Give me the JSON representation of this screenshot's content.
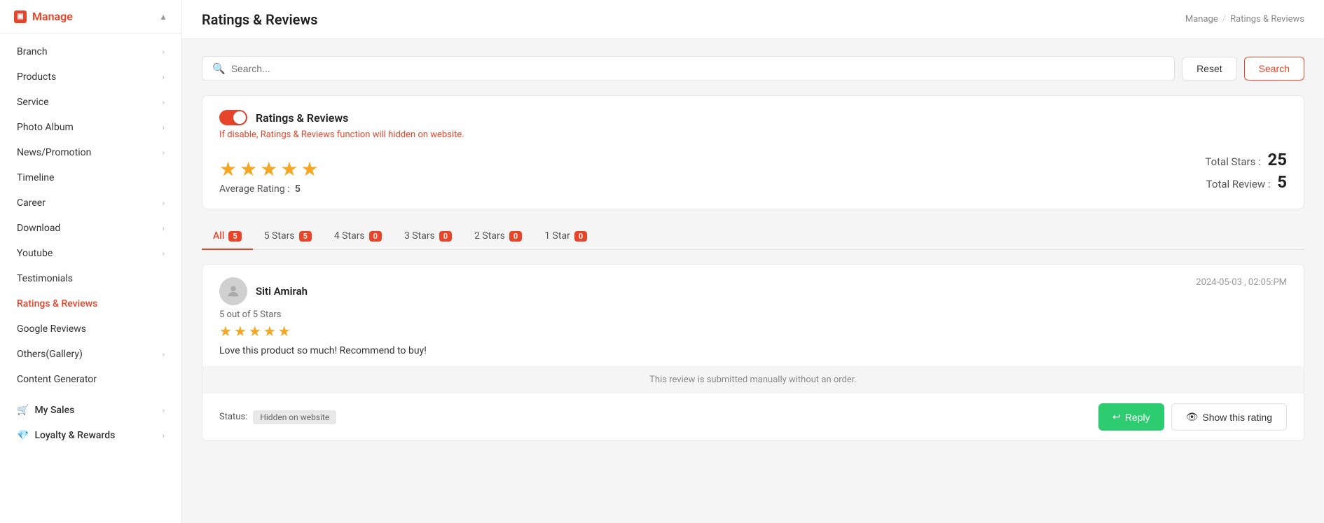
{
  "sidebar": {
    "manage_label": "Manage",
    "items": [
      {
        "id": "branch",
        "label": "Branch",
        "has_chevron": true
      },
      {
        "id": "products",
        "label": "Products",
        "has_chevron": true
      },
      {
        "id": "service",
        "label": "Service",
        "has_chevron": true
      },
      {
        "id": "photo-album",
        "label": "Photo Album",
        "has_chevron": true
      },
      {
        "id": "news-promotion",
        "label": "News/Promotion",
        "has_chevron": true
      },
      {
        "id": "timeline",
        "label": "Timeline",
        "has_chevron": false
      },
      {
        "id": "career",
        "label": "Career",
        "has_chevron": true
      },
      {
        "id": "download",
        "label": "Download",
        "has_chevron": true
      },
      {
        "id": "youtube",
        "label": "Youtube",
        "has_chevron": true
      },
      {
        "id": "testimonials",
        "label": "Testimonials",
        "has_chevron": false
      },
      {
        "id": "ratings-reviews",
        "label": "Ratings & Reviews",
        "has_chevron": false,
        "active": true
      },
      {
        "id": "google-reviews",
        "label": "Google Reviews",
        "has_chevron": false
      },
      {
        "id": "others-gallery",
        "label": "Others(Gallery)",
        "has_chevron": true
      },
      {
        "id": "content-generator",
        "label": "Content Generator",
        "has_chevron": false
      }
    ],
    "sections": [
      {
        "id": "my-sales",
        "label": "My Sales",
        "icon": "🛒"
      },
      {
        "id": "loyalty-rewards",
        "label": "Loyalty & Rewards",
        "icon": "💎"
      }
    ]
  },
  "header": {
    "page_title": "Ratings & Reviews",
    "breadcrumb_root": "Manage",
    "breadcrumb_current": "Ratings & Reviews"
  },
  "search": {
    "placeholder": "Search...",
    "reset_label": "Reset",
    "search_label": "Search"
  },
  "ratings_overview": {
    "toggle_label": "Ratings & Reviews",
    "toggle_desc": "If disable, Ratings & Reviews function will hidden on website.",
    "toggle_on": true,
    "avg_rating_label": "Average Rating :",
    "avg_rating_value": "5",
    "total_stars_label": "Total Stars :",
    "total_stars_value": "25",
    "total_review_label": "Total Review :",
    "total_review_value": "5",
    "stars_count": 5
  },
  "filter_tabs": [
    {
      "id": "all",
      "label": "All",
      "count": "5",
      "active": true
    },
    {
      "id": "5stars",
      "label": "5 Stars",
      "count": "5",
      "active": false
    },
    {
      "id": "4stars",
      "label": "4 Stars",
      "count": "0",
      "active": false
    },
    {
      "id": "3stars",
      "label": "3 Stars",
      "count": "0",
      "active": false
    },
    {
      "id": "2stars",
      "label": "2 Stars",
      "count": "0",
      "active": false
    },
    {
      "id": "1star",
      "label": "1 Star",
      "count": "0",
      "active": false
    }
  ],
  "reviews": [
    {
      "id": "review-1",
      "reviewer_name": "Siti Amirah",
      "date": "2024-05-03 , 02:05:PM",
      "rating_text": "5 out of 5 Stars",
      "stars_count": 5,
      "review_text": "Love this product so much! Recommend to buy!",
      "notice_text": "This review is submitted manually without an order.",
      "status_label": "Status:",
      "status_badge": "Hidden on website",
      "reply_label": "Reply",
      "show_rating_label": "Show this rating"
    }
  ]
}
